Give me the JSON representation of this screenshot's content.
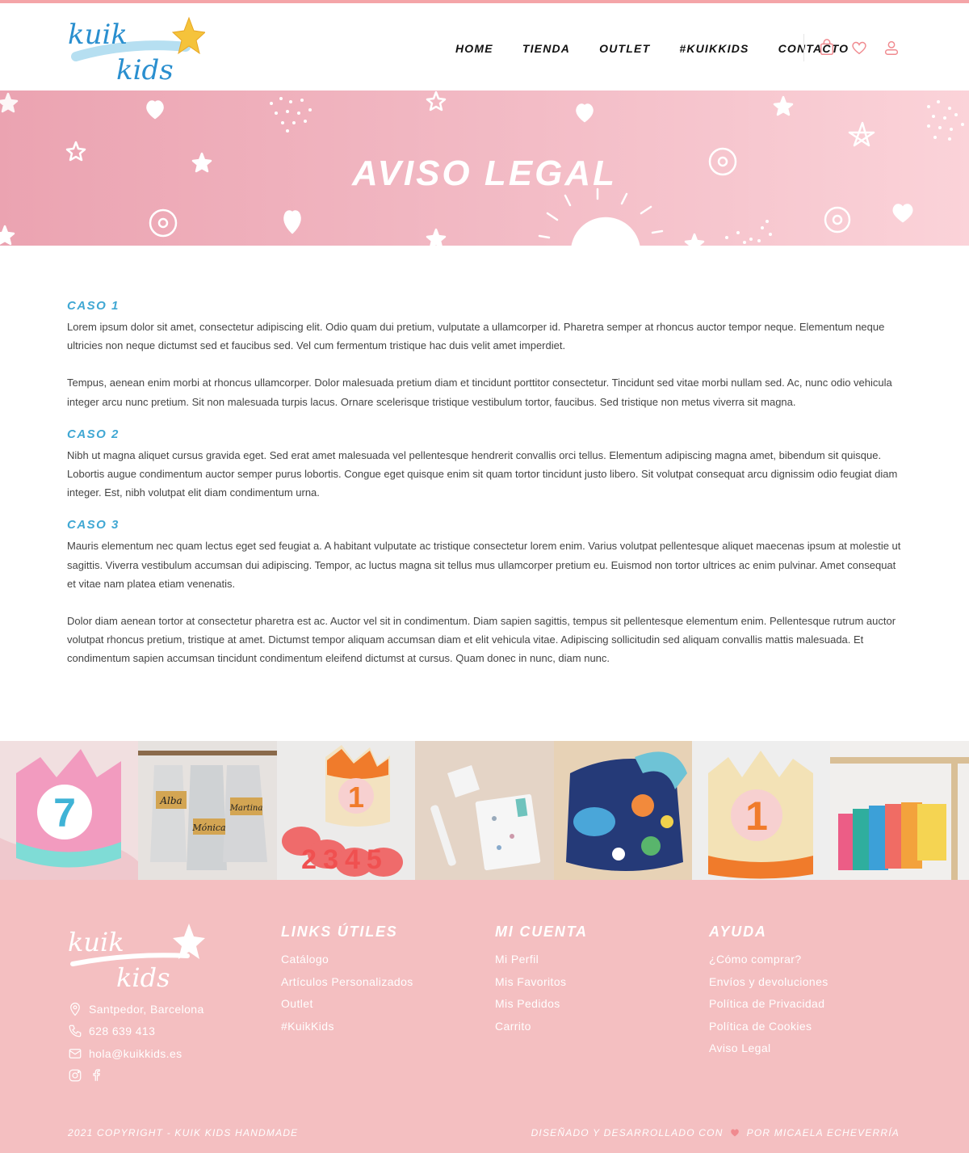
{
  "brand": {
    "logo_text_top": "kuik",
    "logo_text_bottom": "kids",
    "accent": "#f4a5a8",
    "blue": "#3fa7d3",
    "footer_bg": "#f4bfc1"
  },
  "nav": {
    "items": [
      "HOME",
      "TIENDA",
      "OUTLET",
      "#KUIKKIDS",
      "CONTACTO"
    ],
    "icons": [
      "bag-icon",
      "heart-icon",
      "user-icon"
    ]
  },
  "banner": {
    "title": "AVISO LEGAL"
  },
  "content": {
    "sections": [
      {
        "title": "CASO 1",
        "paragraphs": [
          "Lorem ipsum dolor sit amet, consectetur adipiscing elit. Odio quam dui pretium, vulputate a ullamcorper id. Pharetra semper at rhoncus auctor tempor neque. Elementum neque ultricies non neque dictumst sed et faucibus sed. Vel cum fermentum tristique hac duis velit amet imperdiet.",
          "Tempus, aenean enim morbi at rhoncus ullamcorper. Dolor malesuada pretium diam et tincidunt porttitor consectetur. Tincidunt sed vitae morbi nullam sed. Ac, nunc odio vehicula integer arcu nunc pretium. Sit non malesuada turpis lacus. Ornare scelerisque tristique vestibulum tortor, faucibus. Sed tristique non metus viverra sit magna."
        ]
      },
      {
        "title": "CASO 2",
        "paragraphs": [
          "Nibh ut magna aliquet cursus gravida eget. Sed erat amet malesuada vel pellentesque hendrerit convallis orci tellus. Elementum adipiscing magna amet, bibendum sit quisque. Lobortis augue condimentum auctor semper purus lobortis. Congue eget quisque enim sit quam tortor tincidunt justo libero. Sit volutpat consequat arcu dignissim odio feugiat diam integer. Est, nibh volutpat elit diam condimentum urna."
        ]
      },
      {
        "title": "CASO 3",
        "paragraphs": [
          "Mauris elementum nec quam lectus eget sed feugiat a. A habitant vulputate ac tristique consectetur lorem enim. Varius volutpat pellentesque aliquet maecenas ipsum at molestie ut sagittis. Viverra vestibulum accumsan dui adipiscing. Tempor, ac luctus magna sit tellus mus ullamcorper pretium eu. Euismod non tortor ultrices ac enim pulvinar. Amet consequat et vitae nam platea etiam venenatis.",
          "Dolor diam aenean tortor at consectetur pharetra est ac. Auctor vel sit in condimentum. Diam sapien sagittis, tempus sit pellentesque elementum enim. Pellentesque rutrum auctor volutpat rhoncus pretium, tristique at amet. Dictumst tempor aliquam accumsan diam et elit vehicula vitae. Adipiscing sollicitudin sed aliquam convallis mattis malesuada. Et condimentum sapien accumsan tincidunt condimentum eleifend dictumst at cursus. Quam donec in nunc, diam nunc."
        ]
      }
    ]
  },
  "gallery": {
    "tiles": [
      {
        "label": "7"
      },
      {
        "label_a": "Alba",
        "label_b": "Mónica",
        "label_c": "Martina"
      },
      {
        "label": "1",
        "digits": "2345"
      },
      {
        "label": ""
      },
      {
        "label": ""
      },
      {
        "label": "1"
      },
      {
        "label": ""
      }
    ]
  },
  "footer": {
    "address": "Santpedor, Barcelona",
    "phone": "628 639 413",
    "email": "hola@kuikkids.es",
    "columns": [
      {
        "title": "LINKS ÚTILES",
        "links": [
          "Catálogo",
          "Artículos Personalizados",
          "Outlet",
          "#KuikKids"
        ]
      },
      {
        "title": "MI CUENTA",
        "links": [
          "Mi Perfil",
          "Mis Favoritos",
          "Mis Pedidos",
          "Carrito"
        ]
      },
      {
        "title": "AYUDA",
        "links": [
          "¿Cómo comprar?",
          "Envíos y devoluciones",
          "Política de Privacidad",
          "Política de Cookies",
          "Aviso Legal"
        ]
      }
    ],
    "copyright": "2021 COPYRIGHT - KUIK KIDS HANDMADE",
    "credit_prefix": "DISEÑADO Y DESARROLLADO CON",
    "credit_suffix": "POR MICAELA ECHEVERRÍA"
  }
}
